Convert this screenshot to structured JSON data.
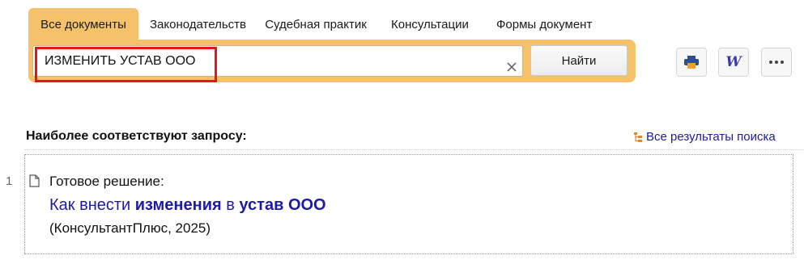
{
  "tabs": [
    {
      "label": "Все документы",
      "active": true
    },
    {
      "label": "Законодательств"
    },
    {
      "label": "Судебная практик"
    },
    {
      "label": "Консультации"
    },
    {
      "label": "Формы документ"
    }
  ],
  "search": {
    "value": "ИЗМЕНИТЬ УСТАВ ООО",
    "button_label": "Найти"
  },
  "toolbar": {
    "icons": [
      "print-icon",
      "word-icon",
      "more-icon"
    ],
    "word_glyph": "W"
  },
  "results_section": {
    "title": "Наиболее соответствуют запросу:",
    "all_results_label": "Все результаты поиска"
  },
  "results": [
    {
      "number": "1",
      "kind": "Готовое решение:",
      "title_parts": [
        {
          "text": "Как внести ",
          "bold": false
        },
        {
          "text": "изменения",
          "bold": true
        },
        {
          "text": " в ",
          "bold": false
        },
        {
          "text": "устав ООО",
          "bold": true
        }
      ],
      "source": "(КонсультантПлюс, 2025)"
    }
  ],
  "colors": {
    "accent": "#f5c26b",
    "link": "#1d1aa5",
    "highlight": "#e0181b",
    "tree_icon": "#e8842c"
  }
}
